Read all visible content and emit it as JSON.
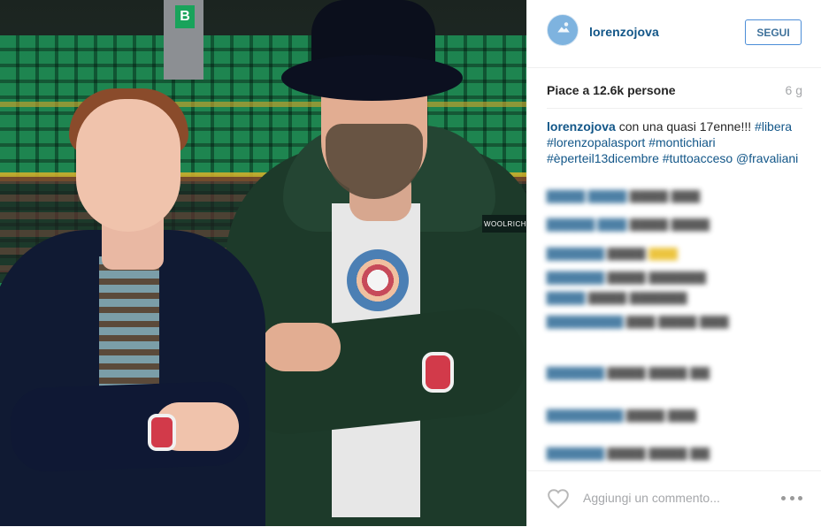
{
  "post": {
    "username": "lorenzojova",
    "follow_label": "SEGUI",
    "likes_text": "Piace a 12.6k persone",
    "age": "6 g",
    "caption": {
      "user": "lorenzojova",
      "text": "con una quasi 17enne!!!",
      "hashtags": [
        "#libera",
        "#lorenzopalasport",
        "#montichiari",
        "#èperteil13dicembre",
        "#tuttoacceso"
      ],
      "mention": "@fravaliani"
    },
    "comment_placeholder": "Aggiungi un commento...",
    "photo_text": {
      "section_label": "B",
      "patch_label": "WOOLRICH"
    }
  },
  "icons": {
    "avatar": "avatar-icon",
    "like": "heart-icon",
    "more": "more-icon"
  },
  "colors": {
    "link": "#125688",
    "follow_border": "#4b8dd7",
    "muted": "#a5a7aa"
  }
}
